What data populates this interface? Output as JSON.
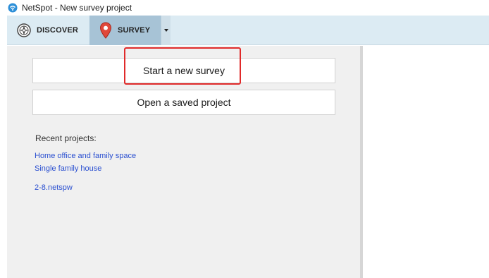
{
  "window": {
    "title": "NetSpot - New survey project",
    "icon": "netspot-app-icon"
  },
  "toolbar": {
    "discover_label": "DISCOVER",
    "survey_label": "SURVEY",
    "discover_icon": "compass-icon",
    "survey_icon": "map-pin-icon",
    "dropdown_icon": "caret-down-icon",
    "active_tab": "SURVEY"
  },
  "actions": {
    "new_survey_label": "Start a new survey",
    "open_project_label": "Open a saved project"
  },
  "recent": {
    "heading": "Recent projects:",
    "items": [
      "Home office and family space",
      "Single family house",
      "2-8.netspw"
    ]
  },
  "colors": {
    "toolbar_bg": "#dcebf3",
    "active_tab_bg": "#a7c3d6",
    "link": "#2a4fd0",
    "highlight": "#e02a2a",
    "pin": "#e0483a"
  }
}
